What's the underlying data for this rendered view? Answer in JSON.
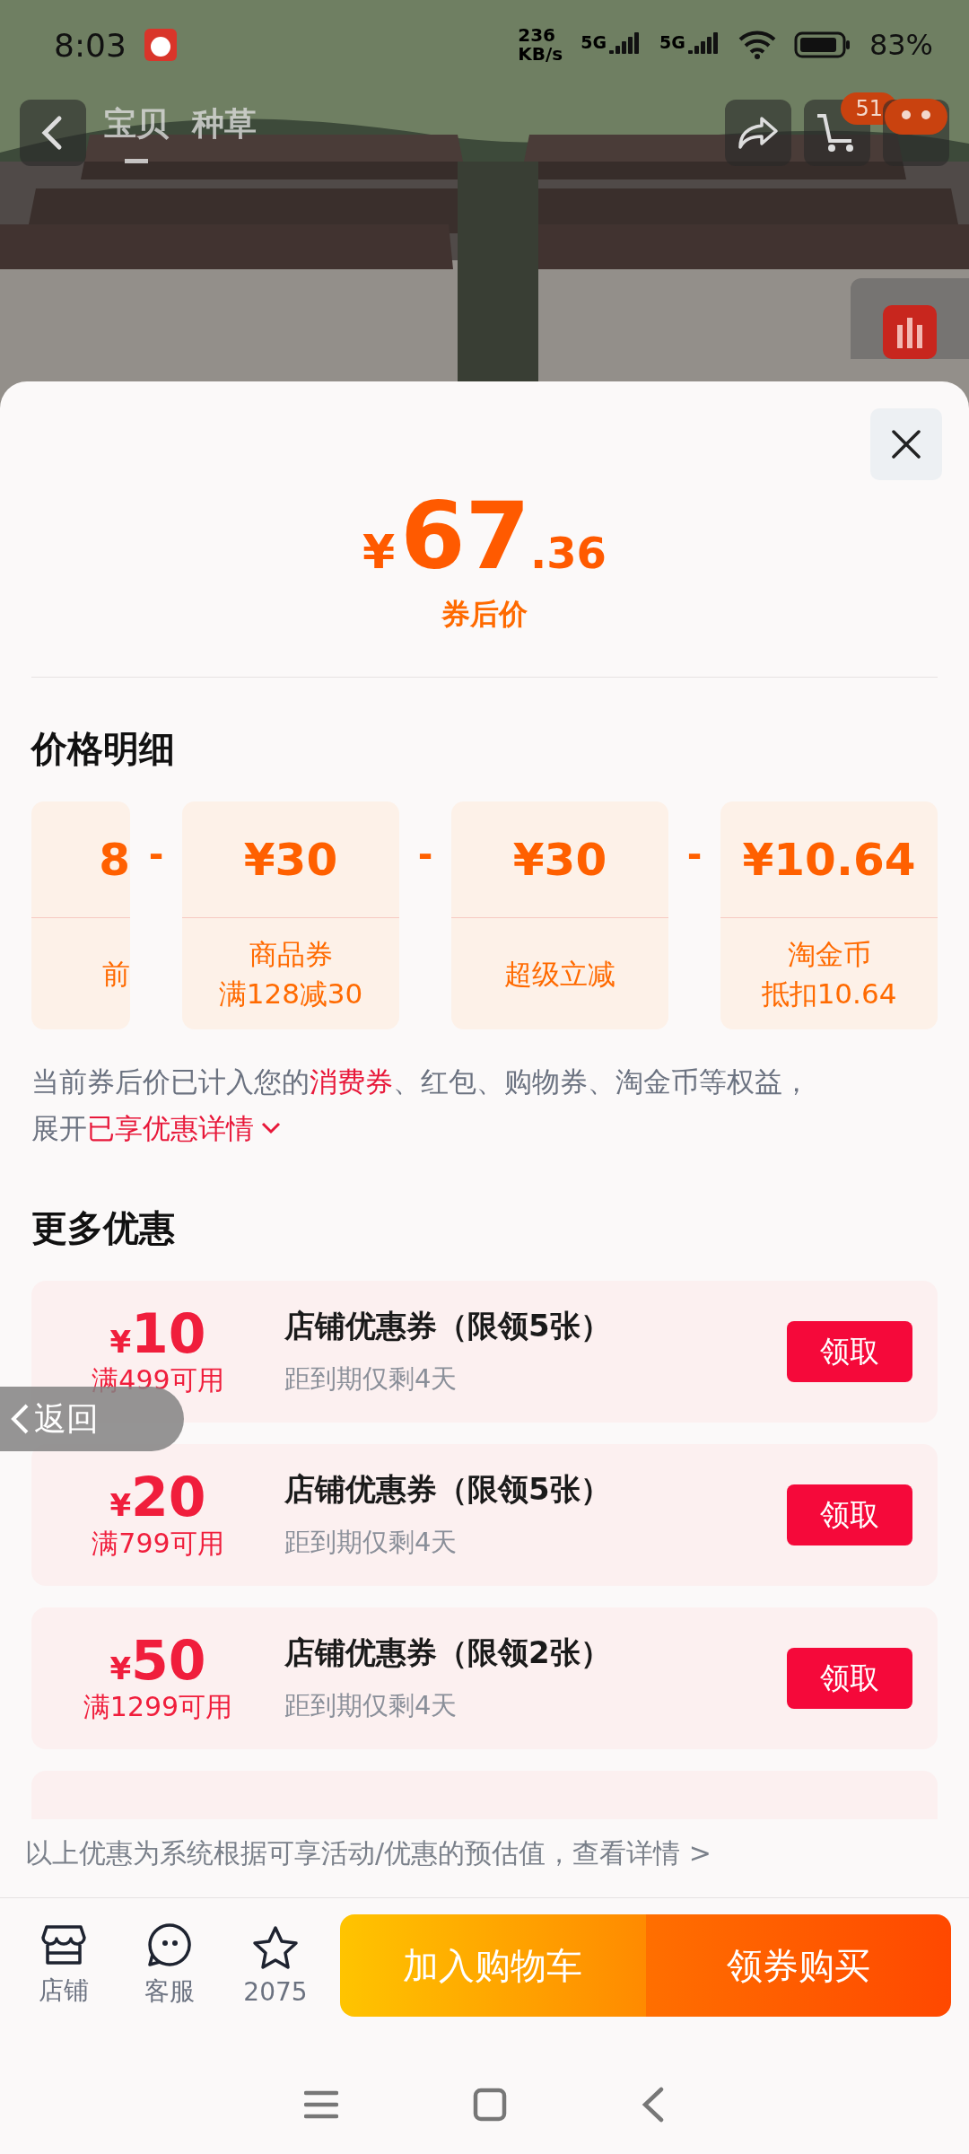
{
  "status_bar": {
    "time": "8:03",
    "speed": "236",
    "speed_unit": "KB/s",
    "networks": [
      "5G",
      "5G"
    ],
    "battery": "83%"
  },
  "header": {
    "tabs": [
      {
        "label": "宝贝",
        "selected": true
      },
      {
        "label": "种草",
        "selected": false
      }
    ],
    "cart_badge": "51"
  },
  "price": {
    "currency": "¥",
    "integer": "67",
    "decimal": ".36",
    "label": "券后价"
  },
  "breakdown": {
    "title": "价格明细",
    "items": [
      {
        "value": "8",
        "lines": [
          "前"
        ]
      },
      {
        "operator": "-",
        "value": "¥30",
        "lines": [
          "商品券",
          "满128减30"
        ]
      },
      {
        "operator": "-",
        "value": "¥30",
        "lines": [
          "超级立减"
        ]
      },
      {
        "operator": "-",
        "value": "¥10.64",
        "lines": [
          "淘金币",
          "抵扣10.64"
        ]
      }
    ]
  },
  "note": {
    "lines": [
      [
        {
          "kind": "plain",
          "text": "当前券后价已计入您的"
        },
        {
          "kind": "highlight",
          "text": "消费券"
        },
        {
          "kind": "plain",
          "text": "、红包、购物券、淘金币等权益，"
        }
      ],
      [
        {
          "kind": "plain",
          "text": "展开"
        },
        {
          "kind": "link",
          "text": "已享优惠详情"
        }
      ]
    ]
  },
  "more": {
    "title": "更多优惠",
    "coupons": [
      {
        "currency": "¥",
        "amount": "10",
        "condition": "满499可用",
        "title": "店铺优惠券（限领5张）",
        "expiry": "距到期仅剩4天",
        "button": "领取"
      },
      {
        "currency": "¥",
        "amount": "20",
        "condition": "满799可用",
        "title": "店铺优惠券（限领5张）",
        "expiry": "距到期仅剩4天",
        "button": "领取"
      },
      {
        "currency": "¥",
        "amount": "50",
        "condition": "满1299可用",
        "title": "店铺优惠券（限领2张）",
        "expiry": "距到期仅剩4天",
        "button": "领取"
      }
    ]
  },
  "disclaimer": "以上优惠为系统根据可享活动/优惠的预估值，查看详情 >",
  "bottom_bar": {
    "actions": [
      {
        "kind": "store",
        "label": "店铺"
      },
      {
        "kind": "service",
        "label": "客服"
      },
      {
        "kind": "favorite",
        "label": "2075"
      }
    ],
    "cart_button": "加入购物车",
    "buy_button": "领券购买"
  },
  "float_back": "返回"
}
